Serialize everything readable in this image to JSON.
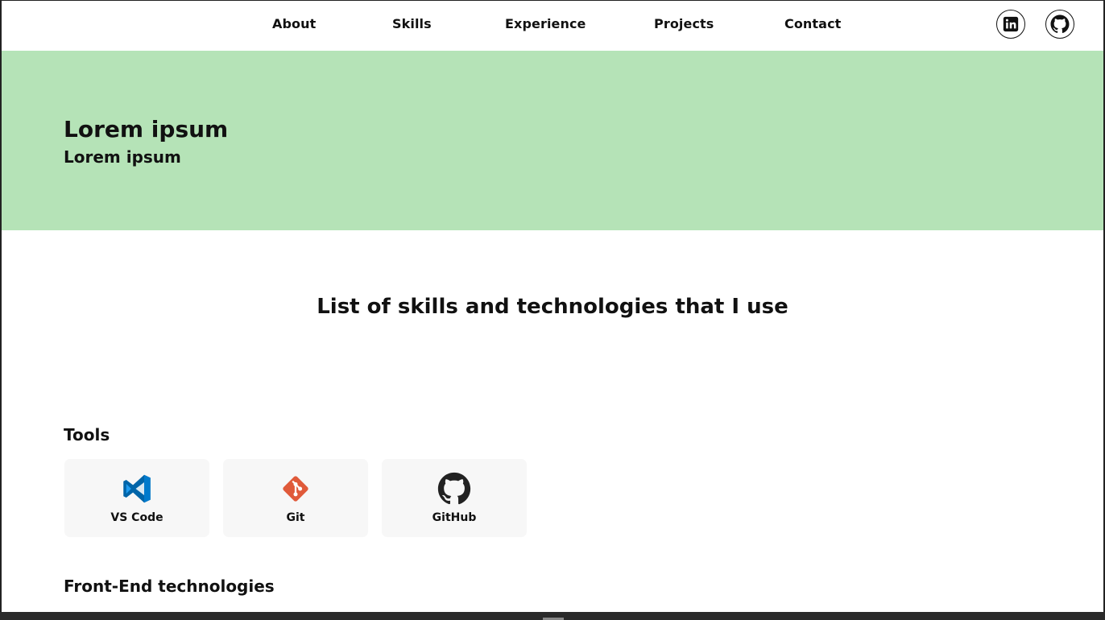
{
  "nav": {
    "links": [
      "About",
      "Skills",
      "Experience",
      "Projects",
      "Contact"
    ],
    "social": [
      "linkedin-icon",
      "github-icon"
    ]
  },
  "hero": {
    "title": "Lorem ipsum",
    "subtitle": "Lorem ipsum",
    "background": "#b5e3b7"
  },
  "skills": {
    "heading": "List of skills and technologies that I use",
    "groups": [
      {
        "title": "Tools",
        "items": [
          {
            "label": "VS Code",
            "icon": "vscode-icon",
            "color": "#0078d4"
          },
          {
            "label": "Git",
            "icon": "git-icon",
            "color": "#e05a3a"
          },
          {
            "label": "GitHub",
            "icon": "github-icon",
            "color": "#222222"
          }
        ]
      },
      {
        "title": "Front-End technologies",
        "items": []
      }
    ]
  }
}
